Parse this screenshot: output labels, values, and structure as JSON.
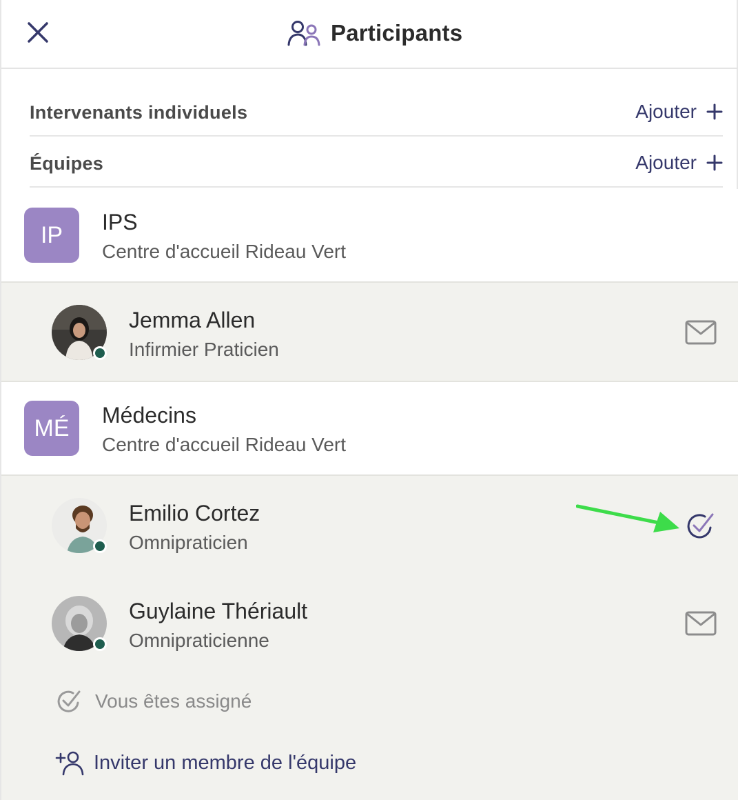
{
  "header": {
    "title": "Participants"
  },
  "sections": {
    "individuals": {
      "label": "Intervenants individuels",
      "add_label": "Ajouter"
    },
    "teams": {
      "label": "Équipes",
      "add_label": "Ajouter"
    }
  },
  "teams": [
    {
      "badge": "IP",
      "name": "IPS",
      "subtitle": "Centre d'accueil Rideau Vert",
      "members": [
        {
          "name": "Jemma Allen",
          "role": "Infirmier Praticien",
          "action_icon": "mail-icon"
        }
      ]
    },
    {
      "badge": "MÉ",
      "name": "Médecins",
      "subtitle": "Centre d'accueil Rideau Vert",
      "members": [
        {
          "name": "Emilio Cortez",
          "role": "Omnipraticien",
          "action_icon": "check-circle-icon"
        },
        {
          "name": "Guylaine Thériault",
          "role": "Omnipraticienne",
          "action_icon": "mail-icon"
        }
      ],
      "assigned_label": "Vous êtes assigné",
      "invite_label": "Inviter un membre de l'équipe"
    }
  ],
  "colors": {
    "accent": "#35386b",
    "badge": "#9b86c4",
    "presence": "#1f5e4f",
    "annotation_arrow": "#3ddc4a",
    "member_bg": "#f2f2ee"
  }
}
